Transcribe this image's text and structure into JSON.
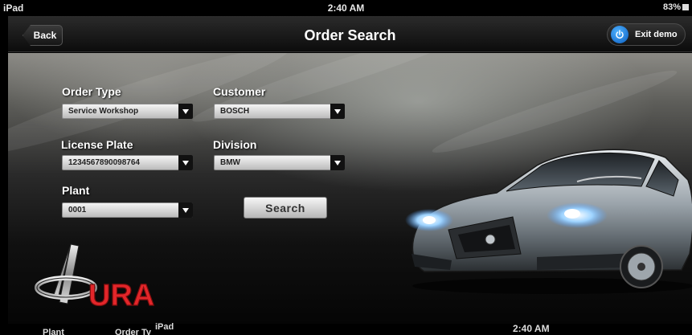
{
  "status_bar": {
    "device": "iPad",
    "time": "2:40 AM",
    "battery": "83%"
  },
  "nav": {
    "back_label": "Back",
    "title": "Order Search",
    "exit_label": "Exit demo"
  },
  "form": {
    "order_type": {
      "label": "Order Type",
      "value": "Service Workshop"
    },
    "customer": {
      "label": "Customer",
      "value": "BOSCH"
    },
    "license_plate": {
      "label": "License Plate",
      "value": "1234567890098764"
    },
    "division": {
      "label": "Division",
      "value": "BMW"
    },
    "plant": {
      "label": "Plant",
      "value": "0001"
    },
    "search_label": "Search"
  },
  "logo": {
    "text": "URA"
  },
  "bottom": {
    "col1": "Plant",
    "col2": "Order Ty",
    "device": "iPad",
    "time": "2:40 AM"
  },
  "colors": {
    "logo_red": "#e3262a",
    "accent_blue": "#1f7ad8"
  }
}
